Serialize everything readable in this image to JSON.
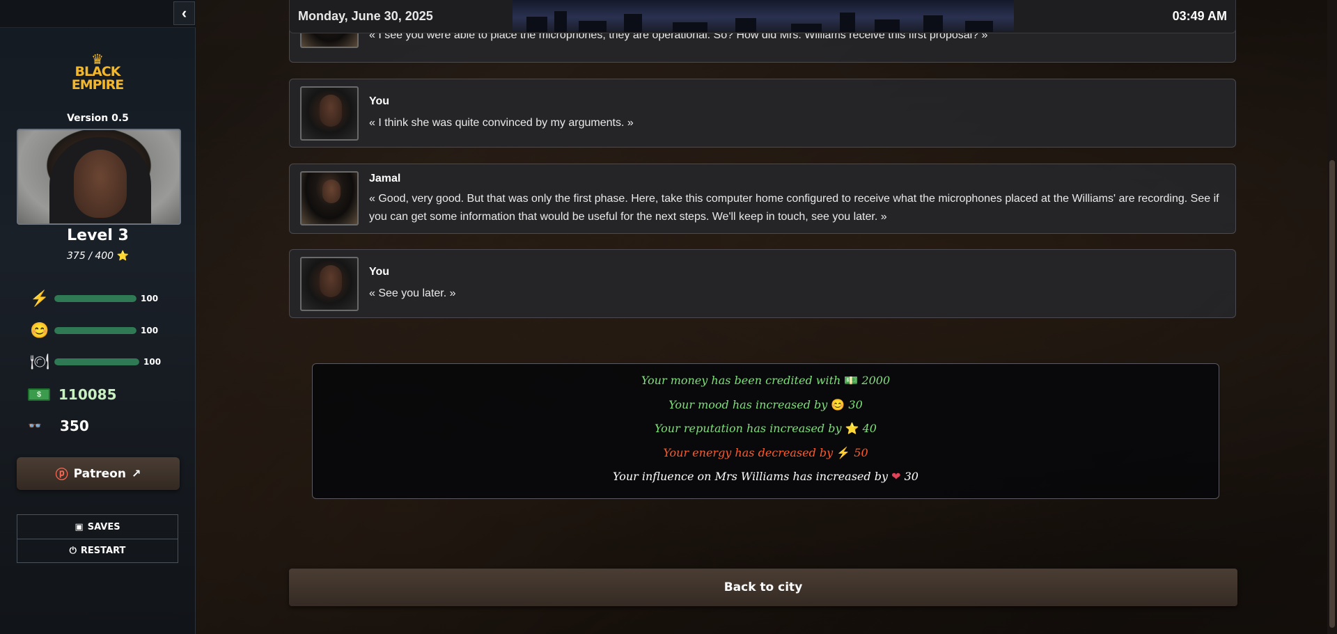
{
  "sidebar": {
    "collapse_icon": "‹",
    "logo": {
      "line1": "BLACK",
      "line2": "EMPIRE"
    },
    "version": "Version 0.5",
    "level": "Level 3",
    "xp": "375 / 400",
    "stats": [
      {
        "icon": "energy-icon",
        "glyph": "⚡",
        "value": "100",
        "fill": 1.0
      },
      {
        "icon": "mood-icon",
        "glyph": "😊",
        "value": "100",
        "fill": 1.0
      },
      {
        "icon": "food-icon",
        "glyph": "🍽",
        "value": "100",
        "fill": 1.0
      }
    ],
    "money": "110085",
    "influence": "350",
    "patreon_label": "Patreon",
    "saves_label": "SAVES",
    "restart_label": "RESTART"
  },
  "header": {
    "date": "Monday, June 30, 2025",
    "time": "03:49 AM"
  },
  "dialogue": [
    {
      "speaker": "",
      "avatar": "jamal",
      "text": "« I see you were able to place the microphones, they are operational. So? How did Mrs. Williams receive this first proposal? »"
    },
    {
      "speaker": "You",
      "avatar": "you",
      "text": "« I think she was quite convinced by my arguments. »"
    },
    {
      "speaker": "Jamal",
      "avatar": "jamal",
      "text": "« Good, very good. But that was only the first phase. Here, take this computer home configured to receive what the microphones placed at the Williams' are recording. See if you can get some information that would be useful for the next steps. We'll keep in touch, see you later. »"
    },
    {
      "speaker": "You",
      "avatar": "you",
      "text": "« See you later. »"
    }
  ],
  "rewards": [
    {
      "text": "Your money has been credited with",
      "icon": "money-icon",
      "glyph": "💵",
      "amount": "2000",
      "tone": "pos"
    },
    {
      "text": "Your mood has increased by",
      "icon": "mood-icon",
      "glyph": "😊",
      "amount": "30",
      "tone": "pos"
    },
    {
      "text": "Your reputation has increased by",
      "icon": "star-icon",
      "glyph": "⭐",
      "amount": "40",
      "tone": "pos"
    },
    {
      "text": "Your energy has decreased by",
      "icon": "energy-icon",
      "glyph": "⚡",
      "amount": "50",
      "tone": "neg"
    },
    {
      "text": "Your influence on Mrs Williams has increased by",
      "icon": "heart-icon",
      "glyph": "❤",
      "amount": "30",
      "tone": "neu"
    }
  ],
  "back_button": "Back to city"
}
